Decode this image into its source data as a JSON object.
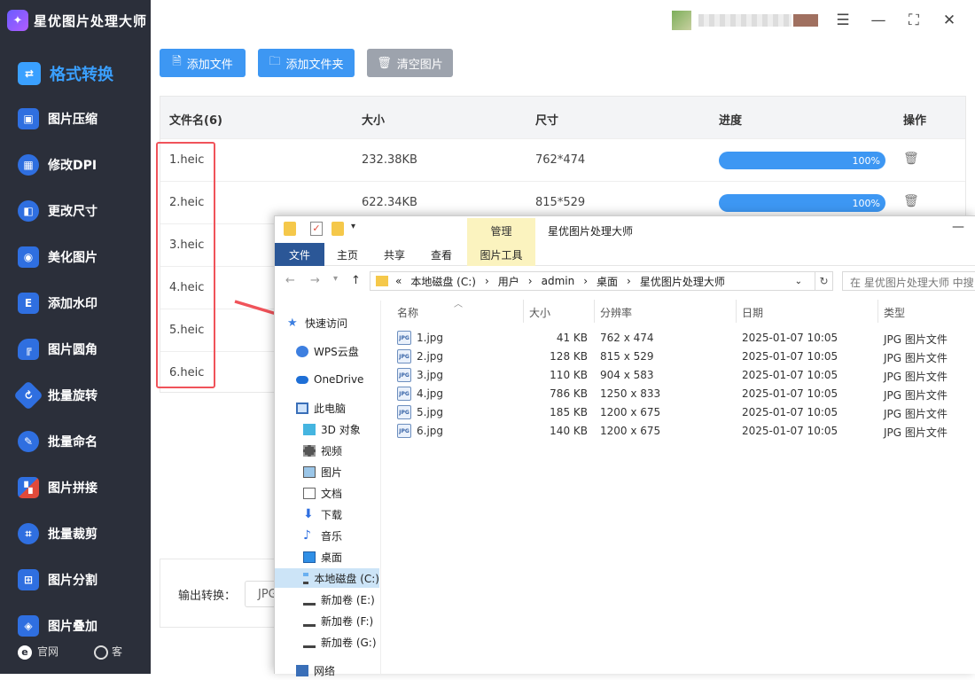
{
  "app": {
    "name": "星优图片处理大师"
  },
  "sidebar": {
    "items": [
      {
        "label": "格式转换",
        "icon": "format-convert-icon",
        "color": "#3aa0ff"
      },
      {
        "label": "图片压缩",
        "icon": "compress-icon",
        "color": "#2f6fe0"
      },
      {
        "label": "修改DPI",
        "icon": "dpi-icon",
        "color": "#2f6fe0"
      },
      {
        "label": "更改尺寸",
        "icon": "resize-icon",
        "color": "#2f6fe0"
      },
      {
        "label": "美化图片",
        "icon": "beautify-icon",
        "color": "#2f6fe0"
      },
      {
        "label": "添加水印",
        "icon": "watermark-icon",
        "color": "#2f6fe0"
      },
      {
        "label": "图片圆角",
        "icon": "round-corner-icon",
        "color": "#2f6fe0"
      },
      {
        "label": "批量旋转",
        "icon": "rotate-icon",
        "color": "#2f6fe0"
      },
      {
        "label": "批量命名",
        "icon": "rename-icon",
        "color": "#2f6fe0"
      },
      {
        "label": "图片拼接",
        "icon": "stitch-icon",
        "color": "#e04a3a"
      },
      {
        "label": "批量裁剪",
        "icon": "crop-icon",
        "color": "#2f6fe0"
      },
      {
        "label": "图片分割",
        "icon": "split-icon",
        "color": "#2f6fe0"
      },
      {
        "label": "图片叠加",
        "icon": "overlay-icon",
        "color": "#2f6fe0"
      }
    ],
    "footer": {
      "website": "官网",
      "service": "客"
    }
  },
  "toolbar": {
    "add_file": "添加文件",
    "add_folder": "添加文件夹",
    "clear": "清空图片"
  },
  "table": {
    "headers": {
      "name": "文件名(6)",
      "size": "大小",
      "dims": "尺寸",
      "progress": "进度",
      "action": "操作"
    },
    "rows": [
      {
        "name": "1.heic",
        "size": "232.38KB",
        "dims": "762*474",
        "progress": "100%"
      },
      {
        "name": "2.heic",
        "size": "622.34KB",
        "dims": "815*529",
        "progress": "100%"
      },
      {
        "name": "3.heic"
      },
      {
        "name": "4.heic"
      },
      {
        "name": "5.heic"
      },
      {
        "name": "6.heic"
      }
    ]
  },
  "output": {
    "label": "输出转换：",
    "value": "JPG"
  },
  "explorer": {
    "title": "星优图片处理大师",
    "manage_tab": "管理",
    "ribbon": [
      "文件",
      "主页",
      "共享",
      "查看",
      "图片工具"
    ],
    "path": [
      "«",
      "本地磁盘 (C:)",
      "›",
      "用户",
      "›",
      "admin",
      "›",
      "桌面",
      "›",
      "星优图片处理大师"
    ],
    "search_placeholder": "在 星优图片处理大师 中搜",
    "nav": [
      {
        "label": "快速访问",
        "icon": "star-icon"
      },
      {
        "label": "WPS云盘",
        "icon": "wps-cloud-icon"
      },
      {
        "label": "OneDrive",
        "icon": "onedrive-icon"
      },
      {
        "label": "此电脑",
        "icon": "computer-icon"
      },
      {
        "label": "3D 对象",
        "icon": "3d-objects-icon"
      },
      {
        "label": "视频",
        "icon": "video-icon"
      },
      {
        "label": "图片",
        "icon": "pictures-icon"
      },
      {
        "label": "文档",
        "icon": "documents-icon"
      },
      {
        "label": "下载",
        "icon": "download-icon"
      },
      {
        "label": "音乐",
        "icon": "music-icon"
      },
      {
        "label": "桌面",
        "icon": "desktop-icon"
      },
      {
        "label": "本地磁盘 (C:)",
        "icon": "local-disk-icon"
      },
      {
        "label": "新加卷 (E:)",
        "icon": "drive-icon"
      },
      {
        "label": "新加卷 (F:)",
        "icon": "drive-icon"
      },
      {
        "label": "新加卷 (G:)",
        "icon": "drive-icon"
      },
      {
        "label": "网络",
        "icon": "network-icon"
      }
    ],
    "columns": {
      "name": "名称",
      "size": "大小",
      "resolution": "分辨率",
      "date": "日期",
      "type": "类型"
    },
    "files": [
      {
        "name": "1.jpg",
        "size": "41 KB",
        "resolution": "762 x 474",
        "date": "2025-01-07 10:05",
        "type": "JPG 图片文件"
      },
      {
        "name": "2.jpg",
        "size": "128 KB",
        "resolution": "815 x 529",
        "date": "2025-01-07 10:05",
        "type": "JPG 图片文件"
      },
      {
        "name": "3.jpg",
        "size": "110 KB",
        "resolution": "904 x 583",
        "date": "2025-01-07 10:05",
        "type": "JPG 图片文件"
      },
      {
        "name": "4.jpg",
        "size": "786 KB",
        "resolution": "1250 x 833",
        "date": "2025-01-07 10:05",
        "type": "JPG 图片文件"
      },
      {
        "name": "5.jpg",
        "size": "185 KB",
        "resolution": "1200 x 675",
        "date": "2025-01-07 10:05",
        "type": "JPG 图片文件"
      },
      {
        "name": "6.jpg",
        "size": "140 KB",
        "resolution": "1200 x 675",
        "date": "2025-01-07 10:05",
        "type": "JPG 图片文件"
      }
    ]
  }
}
